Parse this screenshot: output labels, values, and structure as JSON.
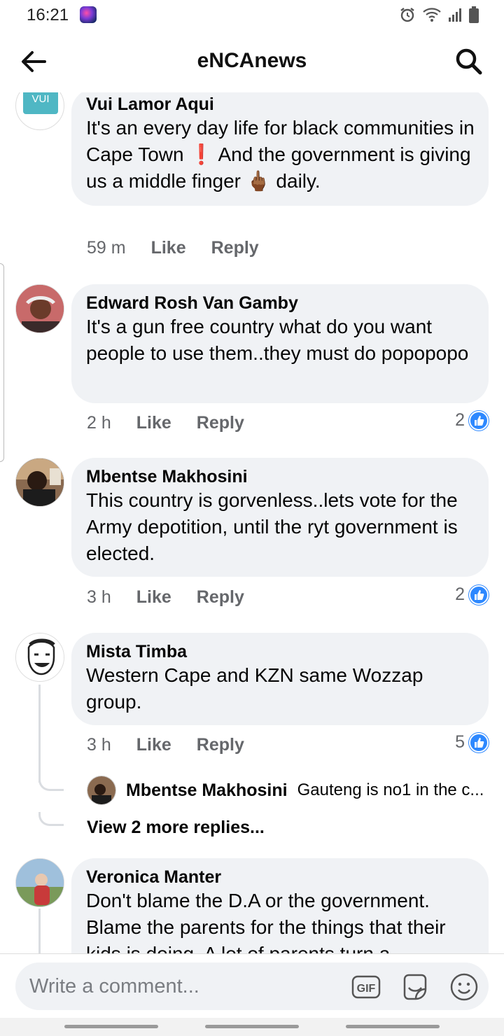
{
  "status_bar": {
    "time": "16:21"
  },
  "header": {
    "title": "eNCAnews"
  },
  "comments": [
    {
      "author": "Vui Lamor Aqui",
      "avatar_text": "VUI",
      "text": "It's an every day life for black communities in Cape Town ❗ And the government is giving us a middle finger 🖕🏾 daily.",
      "time": "59 m",
      "like_label": "Like",
      "reply_label": "Reply",
      "reactions": ""
    },
    {
      "author": "Edward Rosh Van Gamby",
      "text": "It's a gun free country what do you want people to use them..they must do popopopo",
      "time": "2 h",
      "like_label": "Like",
      "reply_label": "Reply",
      "reactions": "2"
    },
    {
      "author": "Mbentse Makhosini",
      "text": "This country is gorvenless..lets vote for the Army depotition, until the ryt government is elected.",
      "time": "3 h",
      "like_label": "Like",
      "reply_label": "Reply",
      "reactions": "2"
    },
    {
      "author": "Mista Timba",
      "text": "Western Cape and KZN same Wozzap group.",
      "time": "3 h",
      "like_label": "Like",
      "reply_label": "Reply",
      "reactions": "5",
      "reply_preview": {
        "author": "Mbentse Makhosini",
        "text": "Gauteng is no1 in the c..."
      },
      "view_more": "View 2 more replies..."
    },
    {
      "author": "Veronica Manter",
      "text": "Don't blame the D.A or the government. Blame the parents for the things that their kids is doing. A lot of parents turn a"
    }
  ],
  "composer": {
    "placeholder": "Write a comment..."
  },
  "colors": {
    "bubble": "#f0f2f5",
    "meta": "#65676b",
    "like_blue": "#2d88ff"
  }
}
